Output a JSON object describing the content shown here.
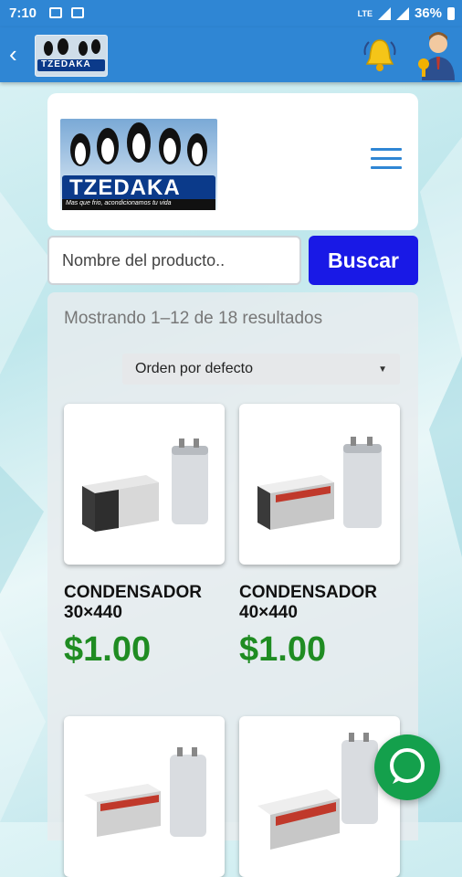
{
  "status_bar": {
    "time": "7:10",
    "battery": "36%",
    "network": "LTE"
  },
  "app_bar": {
    "back_icon": "chevron-left-icon",
    "logo_text": "TZEDAKA"
  },
  "brand": {
    "name": "TZEDAKA",
    "tagline": "Mas que frio, acondicionamos tu vida"
  },
  "search": {
    "placeholder": "Nombre del producto..",
    "button_label": "Buscar"
  },
  "results": {
    "count_text": "Mostrando 1–12 de 18 resultados",
    "sort_label": "Orden por defecto"
  },
  "products": [
    {
      "name": "CONDENSADOR 30×440",
      "price": "$1.00"
    },
    {
      "name": "CONDENSADOR 40×440",
      "price": "$1.00"
    },
    {
      "name": "",
      "price": ""
    },
    {
      "name": "",
      "price": ""
    }
  ],
  "colors": {
    "primary": "#2f86d4",
    "search_button": "#1919e6",
    "price": "#1f8c22",
    "chat": "#14a04c"
  }
}
